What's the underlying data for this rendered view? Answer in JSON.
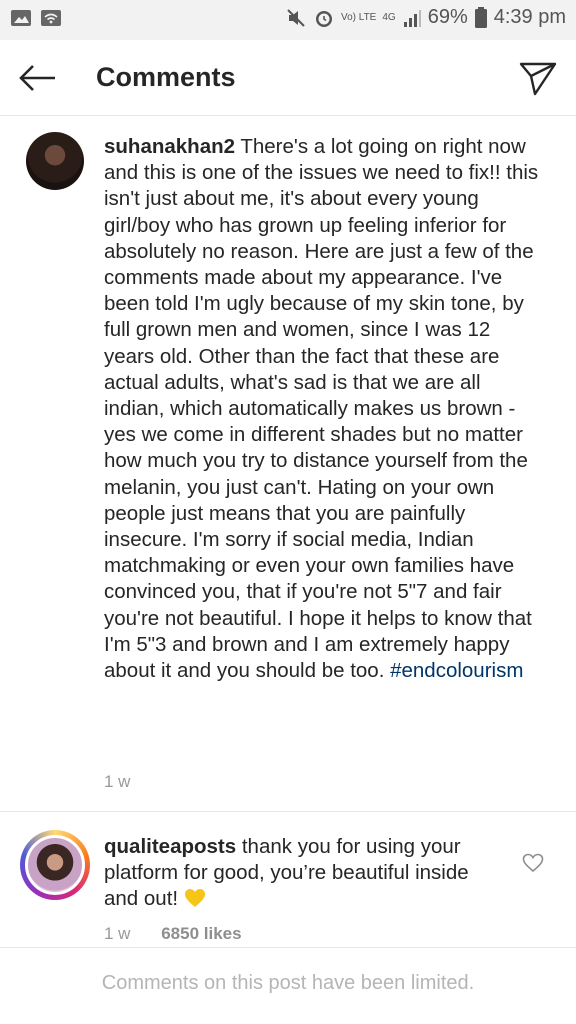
{
  "status_bar": {
    "volte": "Vo) LTE",
    "network": "4G",
    "battery": "69%",
    "time": "4:39 pm",
    "icons": [
      "image-icon",
      "wifi-icon",
      "mute-icon",
      "alarm-icon",
      "signal-icon",
      "battery-icon"
    ]
  },
  "header": {
    "title": "Comments"
  },
  "comments": [
    {
      "username": "suhanakhan2",
      "text": "There's a lot going on right now and this is one of the issues we need to fix!! this isn't just about me, it's about every young girl/boy who has grown up feeling inferior for absolutely no reason. Here are just a few of the comments made about my appearance. I've been told I'm ugly because of my skin tone, by full grown men and women, since I was 12 years old. Other than the fact that these are actual adults, what's sad is that we are all indian, which automatically makes us brown - yes we come in different shades but no matter how much you try to distance yourself from the melanin, you just can't. Hating on your own people just means that you are painfully insecure. I'm sorry if social media, Indian matchmaking or even your own families have convinced you, that if you're not 5\"7 and fair you're not beautiful. I hope it helps to know that I'm 5\"3 and brown and I am extremely happy about it and you should be too.",
      "hashtag": "#endcolourism",
      "time": "1 w"
    },
    {
      "username": "qualiteaposts",
      "text": "thank you for using your platform for good, you’re beautiful inside and out!",
      "time": "1 w",
      "likes": "6850 likes"
    }
  ],
  "footer": {
    "limited_text": "Comments on this post have been limited."
  },
  "colors": {
    "hashtag": "#003569",
    "meta": "#999999",
    "heart": "#f5c518"
  }
}
